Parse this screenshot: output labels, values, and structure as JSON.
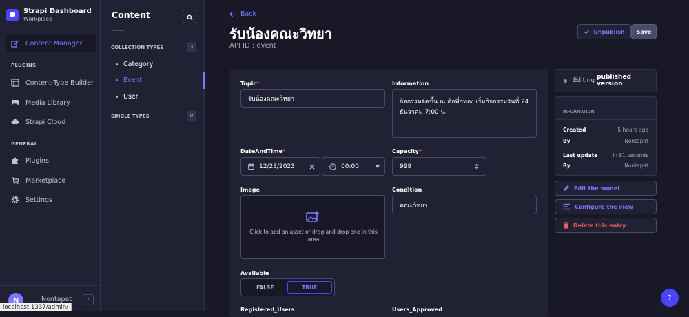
{
  "brand": {
    "name": "Strapi Dashboard",
    "workspace": "Workplace"
  },
  "nav": {
    "content_manager": "Content Manager",
    "plugins_heading": "PLUGINS",
    "ctb": "Content-Type Builder",
    "media": "Media Library",
    "cloud": "Strapi Cloud",
    "general_heading": "GENERAL",
    "plugins": "Plugins",
    "marketplace": "Marketplace",
    "settings": "Settings"
  },
  "user": {
    "initial": "N",
    "name": "Nontapat"
  },
  "status_url": "localhost:1337/admin/",
  "sub": {
    "title": "Content",
    "collection_heading": "COLLECTION TYPES",
    "collection_count": "3",
    "items": [
      "Category",
      "Event",
      "User"
    ],
    "single_heading": "SINGLE TYPES",
    "single_count": "0"
  },
  "header": {
    "back": "Back",
    "title": "รับน้องคณะวิทยา",
    "api_id": "API ID : event",
    "unpublish": "Unpublish",
    "save": "Save"
  },
  "form": {
    "topic_label": "Topic",
    "topic_value": "รับน้องคณะวิทยา",
    "information_label": "Information",
    "information_value": "กิจกรรมจัดขึ้น ณ ตึกพี่กทอง เริ่มกิจกรรมวันที่ 24 ธันวาคม 7:00 น.",
    "datetime_label": "DateAndTime",
    "date_value": "12/23/2023",
    "time_value": "00:00",
    "capacity_label": "Capacity",
    "capacity_value": "999",
    "image_label": "Image",
    "image_hint": "Click to add an asset or drag and drop one in this area",
    "condition_label": "Condition",
    "condition_value": "คณะวิทยา",
    "available_label": "Available",
    "available_false": "FALSE",
    "available_true": "TRUE",
    "registered_label": "Registered_Users",
    "approved_label": "Users_Approved",
    "required_mark": "*"
  },
  "side": {
    "editing": "Editing",
    "published_version": "published version",
    "info_heading": "INFORMATION",
    "created_label": "Created",
    "created_value": "5 hours ago",
    "by_label": "By",
    "created_by": "Nontapat",
    "last_update_label": "Last update",
    "last_update_value": "in 81 seconds",
    "updated_by": "Nontapat",
    "edit_model": "Edit the model",
    "configure_view": "Configure the view",
    "delete_entry": "Delete this entry"
  },
  "help": "?",
  "colors": {
    "accent": "#7b79ff",
    "primary": "#4945ff",
    "danger": "#ee5e52",
    "success": "#5cb176",
    "bg": "#181826",
    "surface": "#212134"
  }
}
